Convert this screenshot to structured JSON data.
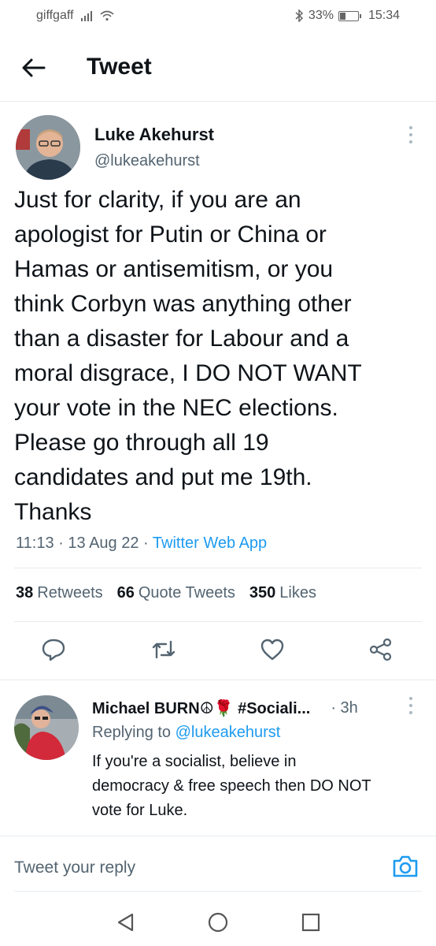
{
  "status_bar": {
    "carrier": "giffgaff",
    "battery": "33%",
    "time": "15:34"
  },
  "header": {
    "back_icon": "arrow-left-icon",
    "title": "Tweet"
  },
  "tweet": {
    "author_name": "Luke Akehurst",
    "author_handle": "@lukeakehurst",
    "text": "Just for clarity, if you are an\napologist for Putin or China or\nHamas or antisemitism, or you\nthink Corbyn was anything other\nthan a disaster for Labour and a\nmoral disgrace, I DO NOT WANT\nyour vote in the NEC elections.\nPlease go through all 19\ncandidates and put me 19th.\nThanks",
    "time": "11:13",
    "date": "13 Aug 22",
    "separator": "·",
    "source": "Twitter Web App",
    "stats": {
      "retweets_count": "38",
      "retweets_label": "Retweets",
      "quote_count": "66",
      "quote_label": "Quote Tweets",
      "likes_count": "350",
      "likes_label": "Likes"
    },
    "actions": [
      "reply-icon",
      "retweet-icon",
      "like-icon",
      "share-icon"
    ]
  },
  "reply": {
    "author_name": "Michael BURN☮🌹 #Sociali...",
    "time": "· 3h",
    "replying_prefix": "Replying to",
    "replying_handle": "@lukeakehurst",
    "text": "If you're a socialist, believe in\ndemocracy & free speech then DO NOT\nvote for Luke."
  },
  "reply_box": {
    "placeholder": "Tweet your reply",
    "icon": "camera-icon"
  },
  "colors": {
    "accent": "#1d9bf0",
    "secondary_text": "#536471",
    "divider": "#e6ecf0"
  }
}
